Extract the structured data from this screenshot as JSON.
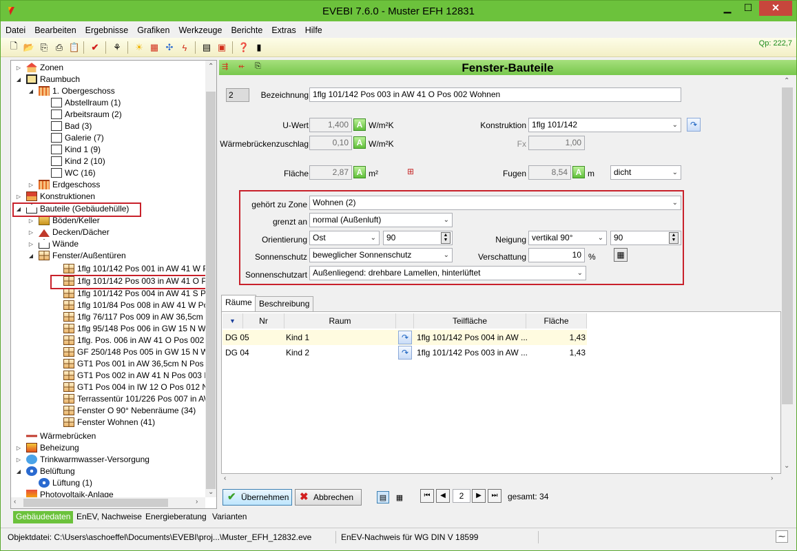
{
  "window": {
    "title": "EVEBI 7.6.0 - Muster EFH 12831"
  },
  "menu": [
    "Datei",
    "Bearbeiten",
    "Ergebnisse",
    "Grafiken",
    "Werkzeuge",
    "Berichte",
    "Extras",
    "Hilfe"
  ],
  "toolbar": {
    "qp": "Qp: 222,7"
  },
  "tree": {
    "items": [
      {
        "label": "Zonen"
      },
      {
        "label": "Raumbuch"
      },
      {
        "label": "1. Obergeschoss"
      },
      {
        "label": "Abstellraum (1)"
      },
      {
        "label": "Arbeitsraum (2)"
      },
      {
        "label": "Bad (3)"
      },
      {
        "label": "Galerie (7)"
      },
      {
        "label": "Kind 1 (9)"
      },
      {
        "label": "Kind 2 (10)"
      },
      {
        "label": "WC (16)"
      },
      {
        "label": "Erdgeschoss"
      },
      {
        "label": "Konstruktionen"
      },
      {
        "label": "Bauteile (Gebäudehülle)"
      },
      {
        "label": "Böden/Keller"
      },
      {
        "label": "Decken/Dächer"
      },
      {
        "label": "Wände"
      },
      {
        "label": "Fenster/Außentüren"
      },
      {
        "label": "1flg 101/142 Pos 001 in AW 41 W Pos"
      },
      {
        "label": "1flg 101/142 Pos 003 in AW 41 O Pos"
      },
      {
        "label": "1flg 101/142 Pos 004 in AW 41 S Pos"
      },
      {
        "label": "1flg 101/84 Pos 008 in AW 41 W Pos"
      },
      {
        "label": "1flg 76/117 Pos 009 in AW 36,5cm N"
      },
      {
        "label": "1flg 95/148 Pos 006 in GW 15 N Wohr"
      },
      {
        "label": "1flg. Pos. 006 in AW 41 O Pos 002 Wo"
      },
      {
        "label": "GF 250/148 Pos 005 in GW 15 N Wohr"
      },
      {
        "label": "GT1 Pos 001 in AW 36,5cm N Pos 001"
      },
      {
        "label": "GT1 Pos 002 in AW 41 N Pos 003 Neb"
      },
      {
        "label": "GT1 Pos 004 in IW 12 O Pos 012 Nebe"
      },
      {
        "label": "Terrassentür 101/226 Pos 007 in AW"
      },
      {
        "label": "Fenster O 90° Nebenräume (34)"
      },
      {
        "label": "Fenster Wohnen (41)"
      },
      {
        "label": "Wärmebrücken"
      },
      {
        "label": "Beheizung"
      },
      {
        "label": "Trinkwarmwasser-Versorgung"
      },
      {
        "label": "Belüftung"
      },
      {
        "label": "Lüftung (1)"
      },
      {
        "label": "Photovoltaik-Anlage"
      }
    ]
  },
  "bottom_tabs": [
    "Gebäudedaten",
    "EnEV, Nachweise",
    "Energieberatung",
    "Varianten"
  ],
  "status": {
    "file": "Objektdatei: C:\\Users\\aschoeffel\\Documents\\EVEBI\\proj...\\Muster_EFH_12832.eve",
    "norm": "EnEV-Nachweis für WG DIN V 18599"
  },
  "main": {
    "header": "Fenster-Bauteile",
    "id": "2",
    "bezeichnung_label": "Bezeichnung",
    "bezeichnung": "1flg 101/142 Pos 003 in AW 41 O Pos 002 Wohnen",
    "uwert_label": "U-Wert",
    "uwert": "1,400",
    "uwert_unit": "W/m²K",
    "wbz_label": "Wärmebrückenzuschlag",
    "wbz": "0,10",
    "wbz_unit": "W/m²K",
    "konstruktion_label": "Konstruktion",
    "konstruktion": "1flg 101/142",
    "fx_label": "Fx",
    "fx": "1,00",
    "flaeche_label": "Fläche",
    "flaeche": "2,87",
    "flaeche_unit": "m²",
    "fugen_label": "Fugen",
    "fugen": "8,54",
    "fugen_unit": "m",
    "fugen_type": "dicht",
    "zone_label": "gehört zu Zone",
    "zone": "Wohnen (2)",
    "grenzt_label": "grenzt an",
    "grenzt": "normal (Außenluft)",
    "orient_label": "Orientierung",
    "orient": "Ost",
    "orient_value": "90",
    "neigung_label": "Neigung",
    "neigung": "vertikal 90°",
    "neigung_value": "90",
    "sonnen_label": "Sonnenschutz",
    "sonnen": "beweglicher Sonnenschutz",
    "verschattung_label": "Verschattung",
    "verschattung": "10",
    "verschattung_unit": "%",
    "sonnenart_label": "Sonnenschutzart",
    "sonnenart": "Außenliegend: drehbare Lamellen, hinterlüftet",
    "btn_a": "A"
  },
  "tabs": [
    "Räume",
    "Beschreibung"
  ],
  "table": {
    "headers": [
      "Nr",
      "Raum",
      "Teilfläche",
      "Fläche"
    ],
    "rows": [
      {
        "nr": "DG 05",
        "raum": "Kind 1",
        "teil": "1flg 101/142 Pos 004 in AW ...",
        "flaeche": "1,43"
      },
      {
        "nr": "DG 04",
        "raum": "Kind 2",
        "teil": "1flg 101/142 Pos 003 in AW ...",
        "flaeche": "1,43"
      }
    ]
  },
  "actions": {
    "ok": "Übernehmen",
    "cancel": "Abbrechen",
    "page": "2",
    "total": "gesamt: 34"
  },
  "colors": {
    "accent": "#6cc23c",
    "highlight": "#c8202a"
  }
}
